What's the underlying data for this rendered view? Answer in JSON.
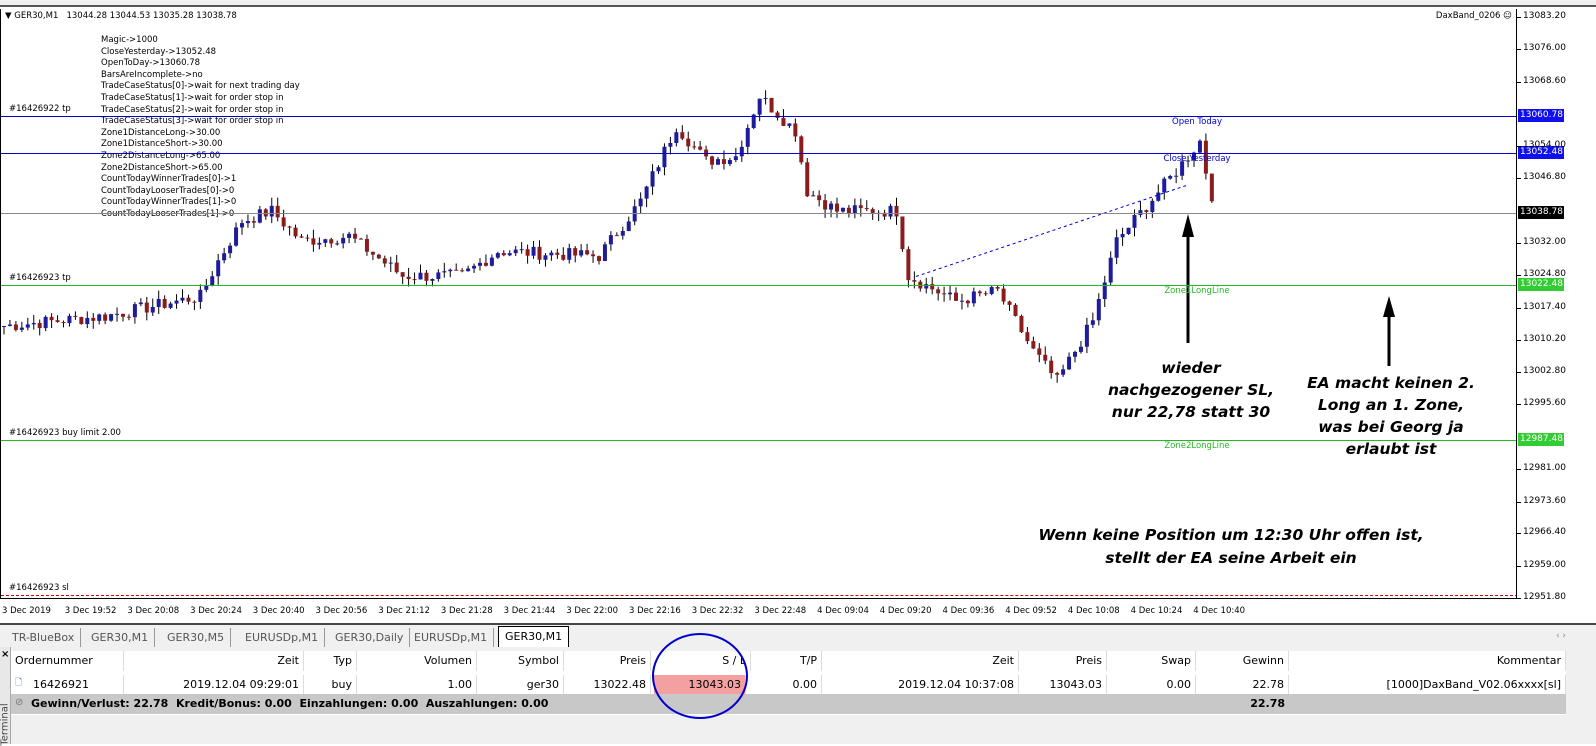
{
  "chart": {
    "symbol_header": "GER30,M1",
    "ohlc": "13044.28 13044.53 13035.28 13038.78",
    "ea_name": "DaxBand_0206",
    "ea_icon": "smiley-icon",
    "info_lines": [
      "Magic->1000",
      "CloseYesterday->13052.48",
      "OpenToDay->13060.78",
      "BarsAreIncomplete->no",
      "TradeCaseStatus[0]->wait for next trading day",
      "TradeCaseStatus[1]->wait for order stop in",
      "TradeCaseStatus[2]->wait for order stop in",
      "TradeCaseStatus[3]->wait for order stop in",
      "Zone1DistanceLong->30.00",
      "Zone1DistanceShort->30.00",
      "Zone2DistanceLong->65.00",
      "Zone2DistanceShort->65.00",
      "CountTodayWinnerTrades[0]->1",
      "CountTodayLooserTrades[0]->0",
      "CountTodayWinnerTrades[1]->0",
      "CountTodayLooserTrades[1]->0"
    ],
    "price_scale": [
      "13083.20",
      "13076.00",
      "13068.60",
      "13054.00",
      "13046.80",
      "13032.00",
      "13024.80",
      "13017.40",
      "13010.20",
      "13002.80",
      "12995.60",
      "12981.00",
      "12973.60",
      "12966.40",
      "12959.00",
      "12951.80"
    ],
    "price_range": [
      12951.8,
      13083.2
    ],
    "lines": [
      {
        "price": 13060.78,
        "tag": "13060.78",
        "color": "#0000cc",
        "left_label": "#16426922 tp",
        "mid_label": "Open Today"
      },
      {
        "price": 13052.48,
        "tag": "13052.48",
        "color": "#0000cc",
        "left_label": "",
        "mid_label": "Close Yesterday"
      },
      {
        "price": 13038.78,
        "tag": "13038.78",
        "color": "#000000",
        "left_label": "",
        "mid_label": ""
      },
      {
        "price": 13022.48,
        "tag": "13022.48",
        "color": "#22bb22",
        "left_label": "#16426923 tp",
        "mid_label": "Zone1LongLine"
      },
      {
        "price": 12987.48,
        "tag": "12987.48",
        "color": "#22bb22",
        "left_label": "#16426923 buy limit 2.00",
        "mid_label": "Zone2LongLine"
      },
      {
        "price": 12952.5,
        "tag": "",
        "color": "#cc0000",
        "left_label": "#16426923 sl",
        "mid_label": ""
      }
    ],
    "time_labels": [
      "3 Dec 2019",
      "3 Dec 19:52",
      "3 Dec 20:08",
      "3 Dec 20:24",
      "3 Dec 20:40",
      "3 Dec 20:56",
      "3 Dec 21:12",
      "3 Dec 21:28",
      "3 Dec 21:44",
      "3 Dec 22:00",
      "3 Dec 22:16",
      "3 Dec 22:32",
      "3 Dec 22:48",
      "4 Dec 09:04",
      "4 Dec 09:20",
      "4 Dec 09:36",
      "4 Dec 09:52",
      "4 Dec 10:08",
      "4 Dec 10:24",
      "4 Dec 10:40"
    ],
    "price_path": [
      [
        0,
        13011.3
      ],
      [
        17,
        13013.5
      ],
      [
        33,
        13018
      ],
      [
        36,
        13026
      ],
      [
        40,
        13035
      ],
      [
        45,
        13037.3
      ],
      [
        50,
        13030.5
      ],
      [
        58,
        13031.6
      ],
      [
        67,
        13022.6
      ],
      [
        77,
        13022.6
      ],
      [
        83,
        13028.2
      ],
      [
        100,
        13027.1
      ],
      [
        107,
        13039.5
      ],
      [
        113,
        13056.5
      ],
      [
        118,
        13048.6
      ],
      [
        123,
        13049.7
      ],
      [
        127,
        13063.3
      ],
      [
        133,
        13055.4
      ],
      [
        135,
        13041.8
      ],
      [
        140,
        13037.3
      ],
      [
        150,
        13037.3
      ],
      [
        152,
        13022.6
      ],
      [
        160,
        13016.9
      ],
      [
        167,
        13019.2
      ],
      [
        173,
        13005.6
      ],
      [
        177,
        12998.8
      ],
      [
        180,
        13005.6
      ],
      [
        183,
        13012.4
      ],
      [
        187,
        13030.5
      ],
      [
        192,
        13038.4
      ],
      [
        197,
        13046.3
      ],
      [
        201,
        13053.1
      ],
      [
        203,
        13039.5
      ]
    ],
    "bull_color": "#1c1c9c",
    "bear_color": "#8b1c1c",
    "annotations": {
      "a1": [
        "wieder",
        "nachgezogener SL,",
        "nur 22,78 statt 30"
      ],
      "a2": [
        "EA macht keinen 2.",
        "Long an 1. Zone,",
        "was bei Georg ja",
        "erlaubt ist"
      ],
      "a3": [
        "Wenn keine Position um 12:30 Uhr offen ist,",
        "stellt der EA seine Arbeit ein"
      ]
    }
  },
  "tabs": [
    {
      "label": "TR-BlueBox"
    },
    {
      "label": "GER30,M1"
    },
    {
      "label": "GER30,M5"
    },
    {
      "label": "EURUSDp,M1"
    },
    {
      "label": "GER30,Daily"
    },
    {
      "label": "EURUSDp,M1"
    },
    {
      "label": "GER30,M1",
      "active": true
    }
  ],
  "terminal": {
    "side_label": "Terminal",
    "columns": [
      "Ordernummer",
      "Zeit",
      "Typ",
      "Volumen",
      "Symbol",
      "Preis",
      "S / L",
      "T/P",
      "Zeit",
      "Preis",
      "Swap",
      "Gewinn",
      "Kommentar"
    ],
    "rows": [
      [
        "16426921",
        "2019.12.04 09:29:01",
        "buy",
        "1.00",
        "ger30",
        "13022.48",
        "13043.03",
        "0.00",
        "2019.12.04 10:37:08",
        "13043.03",
        "0.00",
        "22.78",
        "[1000]DaxBand_V02.06xxxx[sl]"
      ]
    ],
    "summary": "Gewinn/Verlust: 22.78  Kredit/Bonus: 0.00  Einzahlungen: 0.00  Auszahlungen: 0.00",
    "summary_total": "22.78",
    "highlight_color": "#f4a0a0",
    "circle_color": "#0000cc"
  }
}
